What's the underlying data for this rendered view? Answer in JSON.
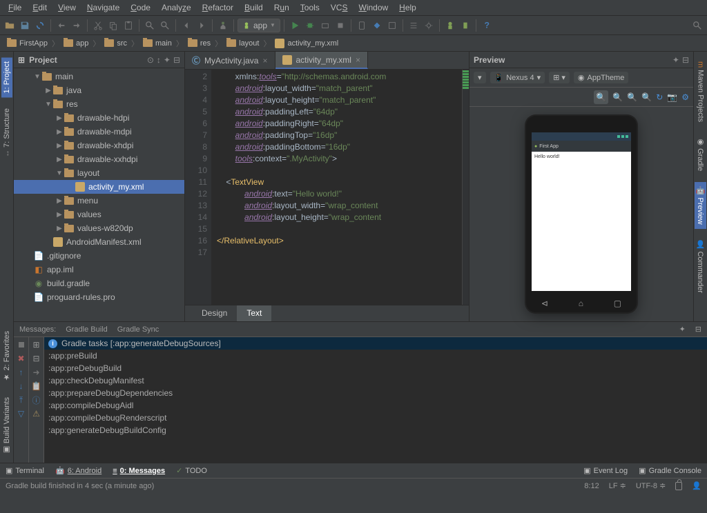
{
  "menu": [
    "File",
    "Edit",
    "View",
    "Navigate",
    "Code",
    "Analyze",
    "Refactor",
    "Build",
    "Run",
    "Tools",
    "VCS",
    "Window",
    "Help"
  ],
  "runConfig": "app",
  "breadcrumb": [
    "FirstApp",
    "app",
    "src",
    "main",
    "res",
    "layout",
    "activity_my.xml"
  ],
  "leftTabs": {
    "project": "1: Project",
    "structure": "7: Structure",
    "favorites": "2: Favorites",
    "build": "Build Variants"
  },
  "rightTabs": {
    "maven": "Maven Projects",
    "gradle": "Gradle",
    "preview": "Preview",
    "commander": "Commander"
  },
  "projectPanel": {
    "title": "Project"
  },
  "tree": {
    "main": "main",
    "java": "java",
    "res": "res",
    "drawable_hdpi": "drawable-hdpi",
    "drawable_mdpi": "drawable-mdpi",
    "drawable_xhdpi": "drawable-xhdpi",
    "drawable_xxhdpi": "drawable-xxhdpi",
    "layout": "layout",
    "activity_my": "activity_my.xml",
    "menu": "menu",
    "values": "values",
    "values_w820dp": "values-w820dp",
    "manifest": "AndroidManifest.xml",
    "gitignore": ".gitignore",
    "app_iml": "app.iml",
    "build_gradle": "build.gradle",
    "proguard": "proguard-rules.pro"
  },
  "editorTabs": {
    "java": "MyActivity.java",
    "xml": "activity_my.xml"
  },
  "lineNumbers": [
    "2",
    "3",
    "4",
    "5",
    "6",
    "7",
    "8",
    "9",
    "10",
    "11",
    "12",
    "13",
    "14",
    "15",
    "16",
    "17"
  ],
  "code": {
    "xmlns_val": "\"http://schemas.android.com",
    "mp": "\"match_parent\"",
    "d64": "\"64dp\"",
    "d16": "\"16dp\"",
    "ctx": "\".MyActivity\"",
    "hello": "\"Hello world!\"",
    "wc": "\"wrap_content",
    "textview": "TextView",
    "closerel": "</RelativeLayout>"
  },
  "bottomEditorTabs": {
    "design": "Design",
    "text": "Text"
  },
  "preview": {
    "title": "Preview",
    "device": "Nexus 4",
    "theme": "AppTheme",
    "appTitle": "First App",
    "body": "Hello world!"
  },
  "messages": {
    "header": {
      "label": "Messages:",
      "gradleBuild": "Gradle Build",
      "gradleSync": "Gradle Sync"
    },
    "title": "Gradle tasks [:app:generateDebugSources]",
    "tasks": [
      ":app:preBuild",
      ":app:preDebugBuild",
      ":app:checkDebugManifest",
      ":app:prepareDebugDependencies",
      ":app:compileDebugAidl",
      ":app:compileDebugRenderscript",
      ":app:generateDebugBuildConfig"
    ]
  },
  "bottomTabs": {
    "terminal": "Terminal",
    "android": "6: Android",
    "msgs": "0: Messages",
    "todo": "TODO",
    "eventLog": "Event Log",
    "gradleConsole": "Gradle Console"
  },
  "status": {
    "msg": "Gradle build finished in 4 sec (a minute ago)",
    "pos": "8:12",
    "sep": "LF",
    "enc": "UTF-8"
  }
}
